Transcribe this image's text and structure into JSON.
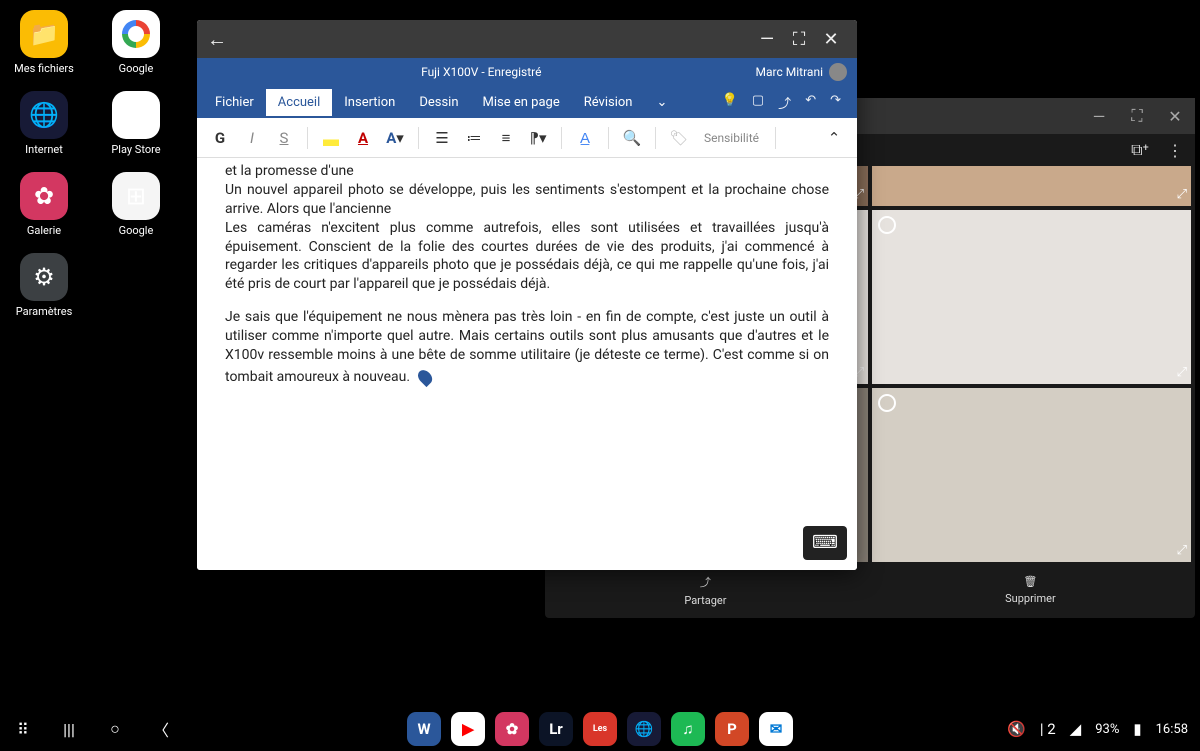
{
  "desktop": {
    "icons": [
      {
        "label": "Mes fichiers"
      },
      {
        "label": "Google"
      },
      {
        "label": "Internet"
      },
      {
        "label": "Play Store"
      },
      {
        "label": "Galerie"
      },
      {
        "label": "Google"
      },
      {
        "label": "Paramètres"
      }
    ]
  },
  "word": {
    "doc_title": "Fuji X100V - Enregistré",
    "user_name": "Marc Mitrani",
    "tabs": {
      "fichier": "Fichier",
      "accueil": "Accueil",
      "insertion": "Insertion",
      "dessin": "Dessin",
      "mise_en_page": "Mise en page",
      "revision": "Révision"
    },
    "ribbon": {
      "sensibilite": "Sensibilité"
    },
    "body": {
      "line1": "et la promesse d'une",
      "p1": "Un nouvel appareil photo se développe, puis les sentiments s'estompent et la prochaine chose arrive. Alors que l'ancienne",
      "p2": "Les caméras n'excitent plus comme autrefois, elles sont utilisées et travaillées jusqu'à épuisement. Conscient de la folie des courtes durées de vie des produits, j'ai commencé à regarder les critiques d'appareils photo que je possédais déjà, ce qui me rappelle qu'une fois, j'ai été pris de court par l'appareil que je possédais déjà.",
      "p3": "Je sais que l'équipement ne nous mènera pas très loin - en fin de compte, c'est juste un outil à utiliser comme n'importe quel autre. Mais certains outils sont plus amusants que d'autres et le X100v ressemble moins à une bête de somme utilitaire (je déteste ce terme). C'est comme si on tombait amoureux à nouveau."
    }
  },
  "gallery": {
    "partager": "Partager",
    "supprimer": "Supprimer"
  },
  "status": {
    "sim": "2",
    "battery": "93%",
    "time": "16:58"
  }
}
